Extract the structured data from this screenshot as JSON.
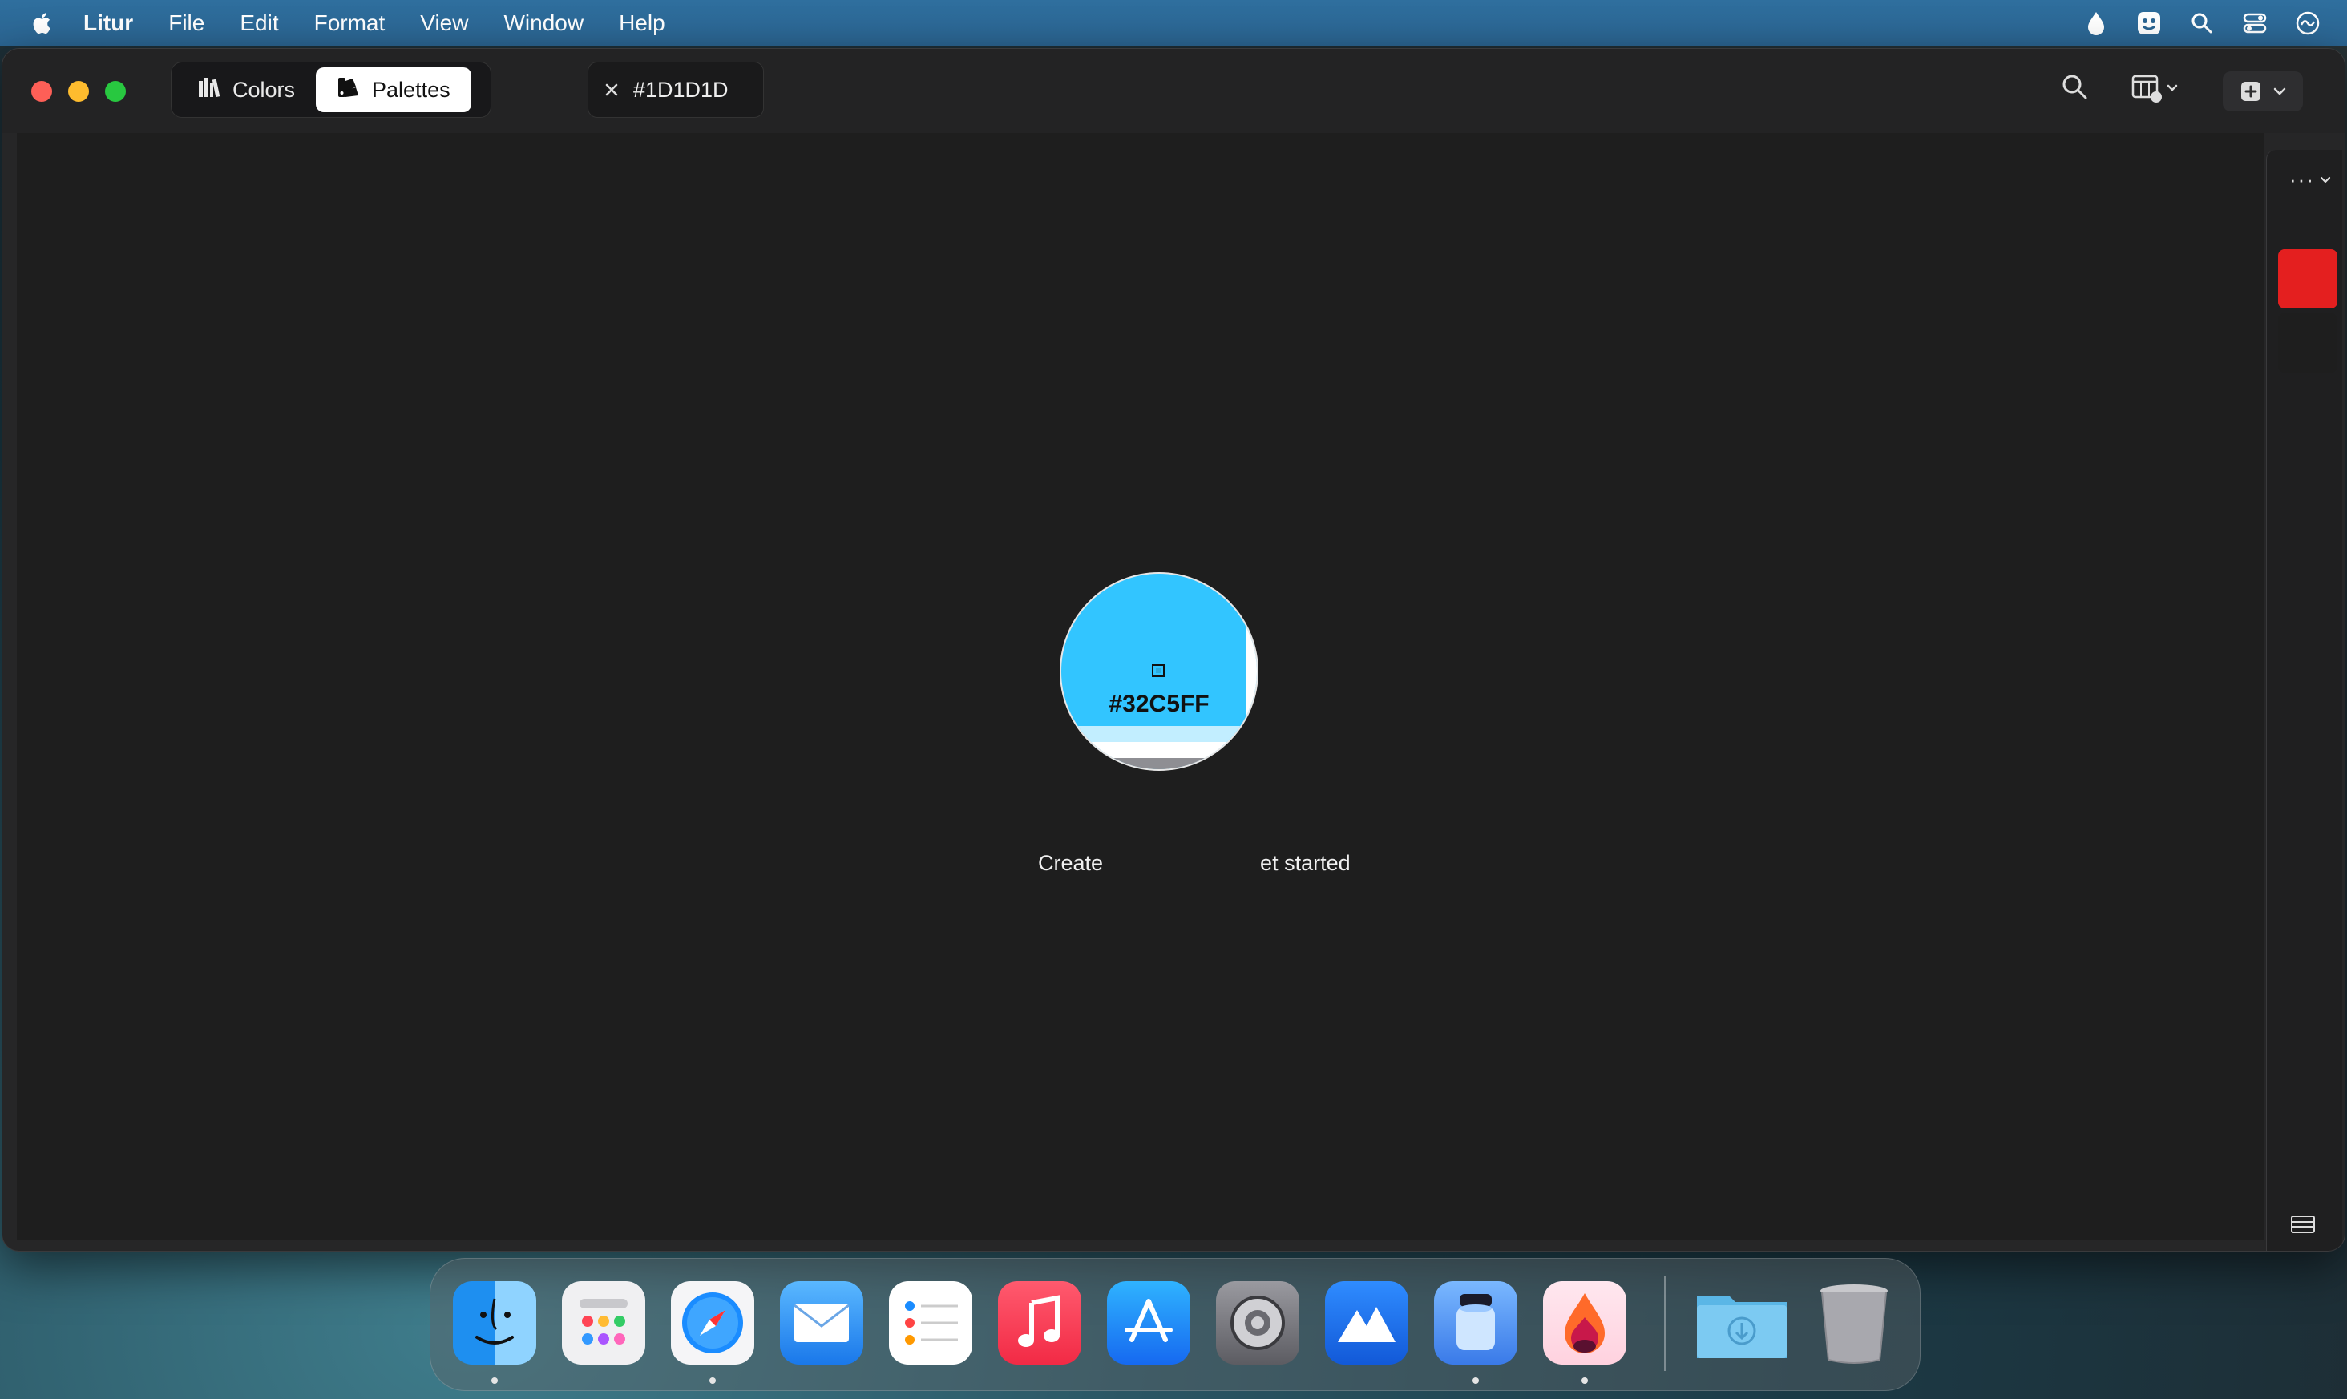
{
  "menubar": {
    "app_name": "Litur",
    "items": [
      "File",
      "Edit",
      "Format",
      "View",
      "Window",
      "Help"
    ],
    "status_icons": [
      "litur-drop-icon",
      "face-app-icon",
      "spotlight-search-icon",
      "control-center-icon",
      "siri-icon"
    ]
  },
  "window": {
    "segments": [
      {
        "label": "Colors",
        "icon": "library-books-icon",
        "active": false
      },
      {
        "label": "Palettes",
        "icon": "palette-icon",
        "active": true
      }
    ],
    "tab": {
      "label": "#1D1D1D"
    },
    "toolbar_icons": [
      "search-icon",
      "grid-format-icon",
      "add-menu-icon"
    ],
    "empty_state": {
      "visible_left": "Create",
      "visible_right": "et started"
    },
    "loupe": {
      "hex": "#32C5FF",
      "color": "#32c5ff"
    },
    "side_panel": {
      "more_label": "···",
      "swatches": [
        "#e41f1f",
        "#1e1e1e"
      ]
    }
  },
  "dock": {
    "apps": [
      {
        "name": "Finder",
        "icon": "finder-icon",
        "running": true
      },
      {
        "name": "Launchpad",
        "icon": "launchpad-icon",
        "running": false
      },
      {
        "name": "Safari",
        "icon": "safari-icon",
        "running": true
      },
      {
        "name": "Mail",
        "icon": "mail-icon",
        "running": false
      },
      {
        "name": "Reminders",
        "icon": "reminders-icon",
        "running": false
      },
      {
        "name": "Music",
        "icon": "music-icon",
        "running": false
      },
      {
        "name": "App Store",
        "icon": "app-store-icon",
        "running": false
      },
      {
        "name": "System Settings",
        "icon": "system-settings-icon",
        "running": false
      },
      {
        "name": "Mountain App",
        "icon": "mountain-app-icon",
        "running": false
      },
      {
        "name": "Preview",
        "icon": "preview-jar-icon",
        "running": true
      },
      {
        "name": "Litur",
        "icon": "litur-app-icon",
        "running": true
      },
      {
        "name": "Downloads",
        "icon": "downloads-folder-icon",
        "running": false
      },
      {
        "name": "Trash",
        "icon": "trash-icon",
        "running": false
      }
    ]
  }
}
